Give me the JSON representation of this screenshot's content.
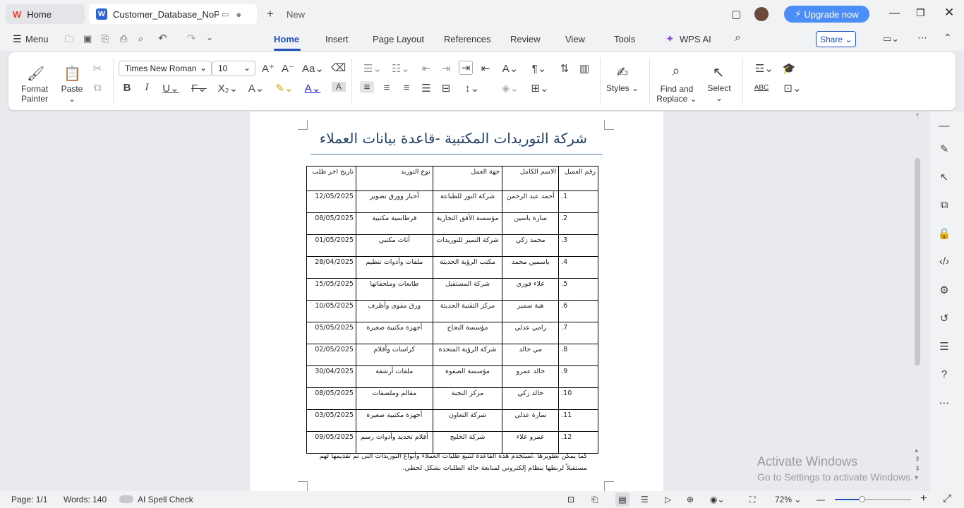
{
  "tabs": {
    "home": "Home",
    "doc": "Customer_Database_NoPhone",
    "new": "New"
  },
  "title_bar": {
    "upgrade": "Upgrade now"
  },
  "menu": {
    "menu": "Menu",
    "items": [
      "Home",
      "Insert",
      "Page Layout",
      "References",
      "Review",
      "View",
      "Tools"
    ],
    "wps_ai": "WPS AI",
    "share": "Share"
  },
  "ribbon": {
    "format_painter_1": "Format",
    "format_painter_2": "Painter",
    "paste": "Paste",
    "font_name": "Times New Roman",
    "font_size": "10",
    "styles": "Styles",
    "find_1": "Find and",
    "find_2": "Replace",
    "select": "Select",
    "abc": "ABC"
  },
  "document": {
    "title": "شركة التوريدات المكتبية -قاعدة بيانات العملاء",
    "headers": [
      "رقم العميل",
      "الاسم الكامل",
      "جهة العمل",
      "نوع التوريد",
      "تاريخ اخر طلب"
    ],
    "rows": [
      [
        "1.",
        "أحمد عبد الرحمن",
        "شركة النور للطباعة",
        "أحبار وورق تصوير",
        "12/05/2025"
      ],
      [
        "2.",
        "سارة ياسين",
        "مؤسسة الأفق التجارية",
        "قرطاسية مكتبية",
        "08/05/2025"
      ],
      [
        "3.",
        "محمد زكي",
        "شركة التميز للتوريدات",
        "أثاث مكتبي",
        "01/05/2025"
      ],
      [
        "4.",
        "ياسمين محمد",
        "مكتب الرؤية الحديثة",
        "ملفات وأدوات تنظيم",
        "28/04/2025"
      ],
      [
        "5.",
        "علاء فوزي",
        "شركة المستقبل",
        "طابعات وملحقاتها",
        "15/05/2025"
      ],
      [
        "6.",
        "هبة سمير",
        "مركز التقنية الحديثة",
        "ورق مقوى وأظرف",
        "10/05/2025"
      ],
      [
        "7.",
        "رامي عدلي",
        "مؤسسة النجاح",
        "أجهزة مكتبية صغيرة",
        "05/05/2025"
      ],
      [
        "8.",
        "مي خالد",
        "شركة الرؤية المتحدة",
        "كراسات وأقلام",
        "02/05/2025"
      ],
      [
        "9.",
        "خالد عمرو",
        "مؤسسة الصفوة",
        "ملفات أرشفة",
        "30/04/2025"
      ],
      [
        "10.",
        "خالد زكي",
        "مركز النخبة",
        "مقالم وملصقات",
        "08/05/2025"
      ],
      [
        "11.",
        "سارة عدلي",
        "شركة التعاون",
        "أجهزة مكتبية صغيرة",
        "03/05/2025"
      ],
      [
        "12.",
        "عمرو علاء",
        "شركة الخليج",
        "أقلام تحديد وأدوات رسم",
        "09/05/2025"
      ]
    ],
    "paragraph_1": "كما يمكن تطويرها .تُستخدم هذه القاعدة لتتبع طلبات العملاء وأنواع التوريدات التي تم تقديمها لهم",
    "paragraph_2": "مستقبلاً لربطها بنظام إلكتروني لمتابعة حالة الطلبات بشكل لحظي."
  },
  "activate": {
    "line1": "Activate Windows",
    "line2": "Go to Settings to activate Windows."
  },
  "status": {
    "page": "Page: 1/1",
    "words": "Words: 140",
    "spell": "AI Spell Check",
    "zoom": "72%"
  }
}
